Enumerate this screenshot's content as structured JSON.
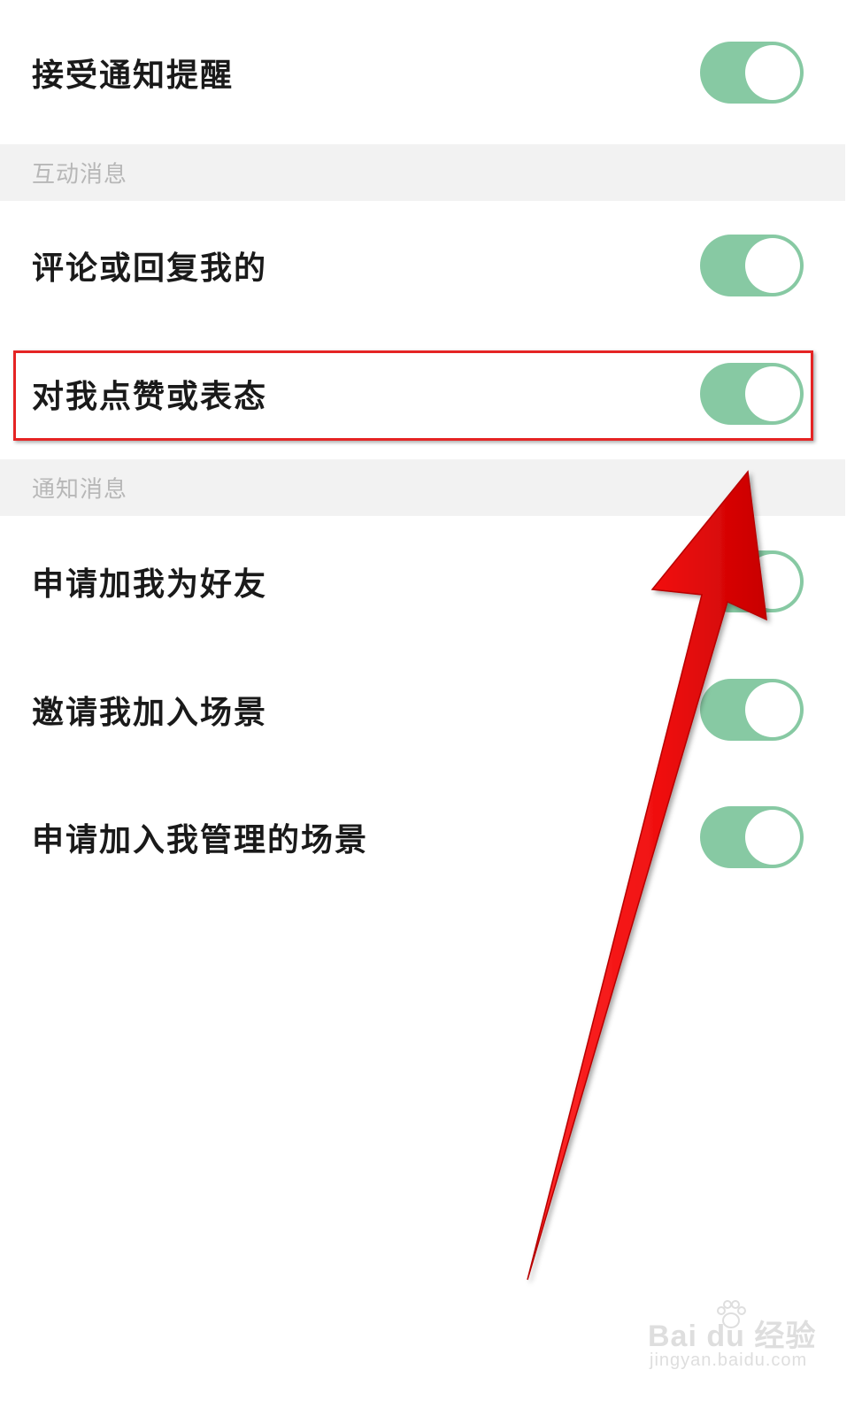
{
  "settings": {
    "receive_notifications": {
      "label": "接受通知提醒",
      "enabled": true
    },
    "sections": [
      {
        "title": "互动消息",
        "items": [
          {
            "label": "评论或回复我的",
            "enabled": true
          },
          {
            "label": "对我点赞或表态",
            "enabled": true
          }
        ]
      },
      {
        "title": "通知消息",
        "items": [
          {
            "label": "申请加我为好友",
            "enabled": true
          },
          {
            "label": "邀请我加入场景",
            "enabled": true
          },
          {
            "label": "申请加入我管理的场景",
            "enabled": true
          }
        ]
      }
    ]
  },
  "watermark": {
    "brand": "Bai du 经验",
    "domain": "jingyan.baidu.com"
  },
  "colors": {
    "toggle_on": "#87c9a3",
    "toggle_knob": "#ffffff",
    "section_bg": "#f2f2f2",
    "section_text": "#b7b7b7",
    "annotation_red": "#e52424"
  },
  "icons": {
    "annotation_arrow": "red-arrow-icon",
    "watermark_logo": "baidu-paw-icon"
  }
}
